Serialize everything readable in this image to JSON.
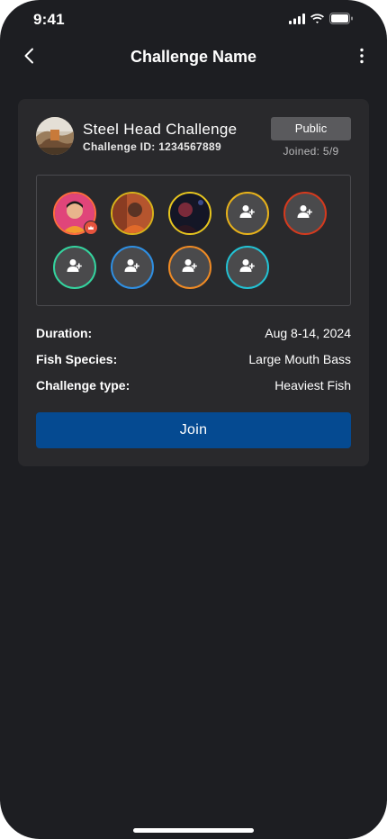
{
  "status_bar": {
    "time": "9:41",
    "icons": [
      "cellular-signal-icon",
      "wifi-icon",
      "battery-icon"
    ]
  },
  "nav": {
    "title": "Challenge Name",
    "back_icon": "chevron-left-icon",
    "more_icon": "more-vertical-icon"
  },
  "challenge": {
    "name": "Steel Head Challenge",
    "id_label": "Challenge ID: 1234567889",
    "visibility": "Public",
    "joined": "Joined: 5/9"
  },
  "participants": [
    {
      "type": "photo",
      "ring": "#ff6b3d",
      "owner": true
    },
    {
      "type": "photo",
      "ring": "#d8b21a",
      "owner": false
    },
    {
      "type": "photo",
      "ring": "#e7c51e",
      "owner": false
    },
    {
      "type": "empty",
      "ring": "#e8b21a",
      "icon": "add-user-icon"
    },
    {
      "type": "empty",
      "ring": "#d43a1e",
      "icon": "add-user-icon"
    },
    {
      "type": "empty",
      "ring": "#34d39e",
      "icon": "add-user-icon"
    },
    {
      "type": "empty",
      "ring": "#2e8fe3",
      "icon": "add-user-icon"
    },
    {
      "type": "empty",
      "ring": "#ef8a24",
      "icon": "add-user-icon"
    },
    {
      "type": "empty",
      "ring": "#22c2d4",
      "icon": "add-user-icon"
    }
  ],
  "details": [
    {
      "label": "Duration:",
      "value": "Aug 8-14, 2024"
    },
    {
      "label": "Fish Species:",
      "value": "Large Mouth Bass"
    },
    {
      "label": "Challenge type:",
      "value": "Heaviest Fish"
    }
  ],
  "actions": {
    "join_label": "Join"
  },
  "colors": {
    "background": "#1d1e22",
    "card": "#29292c",
    "primary": "#054a91"
  }
}
